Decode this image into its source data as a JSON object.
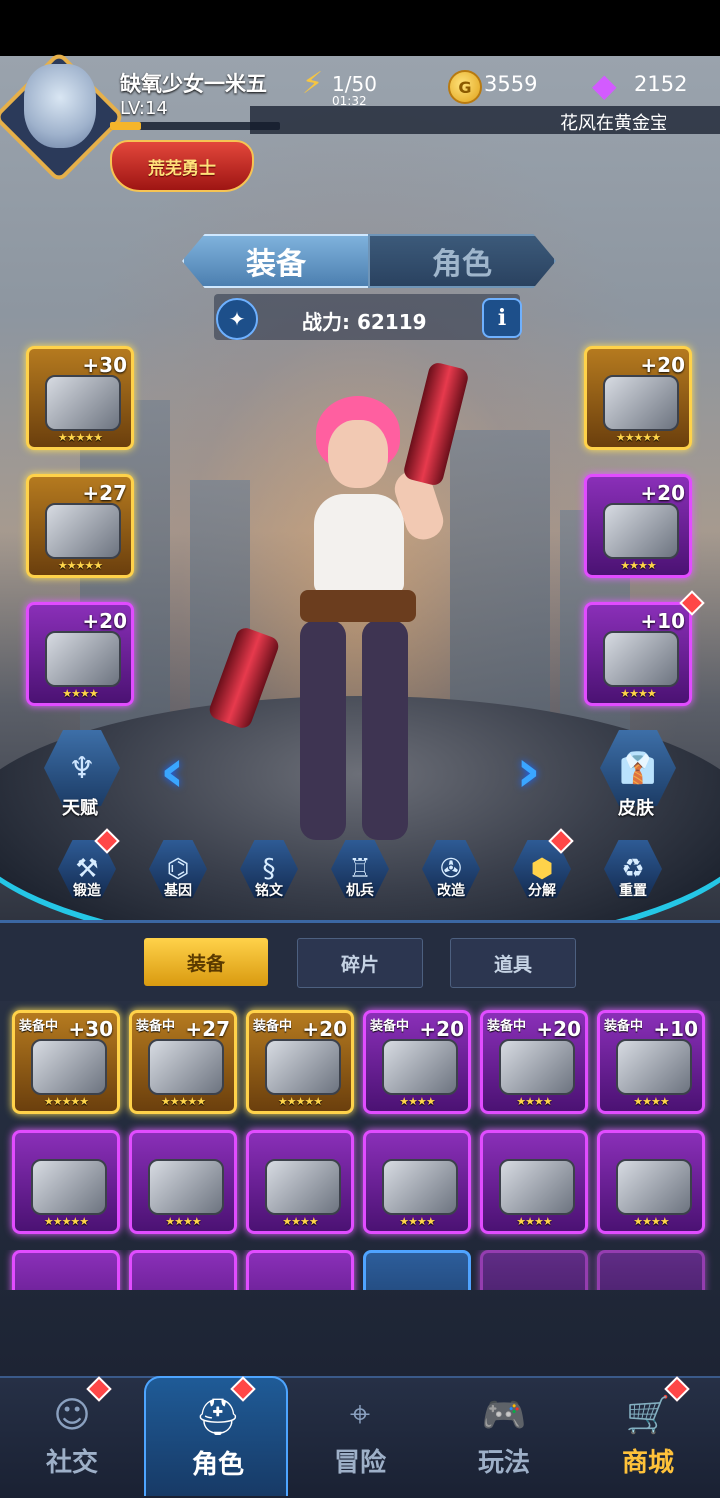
{
  "header": {
    "player_name": "缺氧少女一米五",
    "level": "LV:14",
    "xp_fraction": 0.18,
    "title_badge": "荒芜勇士",
    "energy": "1/50",
    "energy_timer": "01:32",
    "coins": "3559",
    "gems": "2152",
    "ticker": "花风在黄金宝"
  },
  "top_tabs": [
    "装备",
    "角色"
  ],
  "power": {
    "label": "战力: 62119",
    "info": "i"
  },
  "equipped_left": [
    {
      "level": "+30",
      "stars": "★★★★★",
      "rarity": "gold"
    },
    {
      "level": "+27",
      "stars": "★★★★★",
      "rarity": "gold"
    },
    {
      "level": "+20",
      "stars": "★★★★",
      "rarity": "purple"
    }
  ],
  "equipped_right": [
    {
      "level": "+20",
      "stars": "★★★★★",
      "rarity": "gold"
    },
    {
      "level": "+20",
      "stars": "★★★★",
      "rarity": "purple"
    },
    {
      "level": "+10",
      "stars": "★★★★",
      "rarity": "purple"
    }
  ],
  "side_buttons": {
    "talent": "天赋",
    "skin": "皮肤"
  },
  "functions": [
    "锻造",
    "基因",
    "铭文",
    "机兵",
    "改造",
    "分解",
    "重置"
  ],
  "inventory_tabs": [
    "装备",
    "碎片",
    "道具"
  ],
  "inventory_row1": [
    {
      "tag": "装备中",
      "level": "+30",
      "stars": "★★★★★",
      "rarity": "gold"
    },
    {
      "tag": "装备中",
      "level": "+27",
      "stars": "★★★★★",
      "rarity": "gold"
    },
    {
      "tag": "装备中",
      "level": "+20",
      "stars": "★★★★★",
      "rarity": "gold"
    },
    {
      "tag": "装备中",
      "level": "+20",
      "stars": "★★★★",
      "rarity": "purple"
    },
    {
      "tag": "装备中",
      "level": "+20",
      "stars": "★★★★",
      "rarity": "purple"
    },
    {
      "tag": "装备中",
      "level": "+10",
      "stars": "★★★★",
      "rarity": "purple"
    }
  ],
  "inventory_row2": [
    {
      "stars": "★★★★★",
      "rarity": "purple"
    },
    {
      "stars": "★★★★",
      "rarity": "purple"
    },
    {
      "stars": "★★★★",
      "rarity": "purple"
    },
    {
      "stars": "★★★★",
      "rarity": "purple"
    },
    {
      "stars": "★★★★",
      "rarity": "purple"
    },
    {
      "stars": "★★★★",
      "rarity": "purple"
    }
  ],
  "bottom_nav": [
    "社交",
    "角色",
    "冒险",
    "玩法",
    "商城"
  ],
  "colors": {
    "gold": "#ffd24a",
    "purple": "#e14cff",
    "accent": "#4ea5ff"
  }
}
